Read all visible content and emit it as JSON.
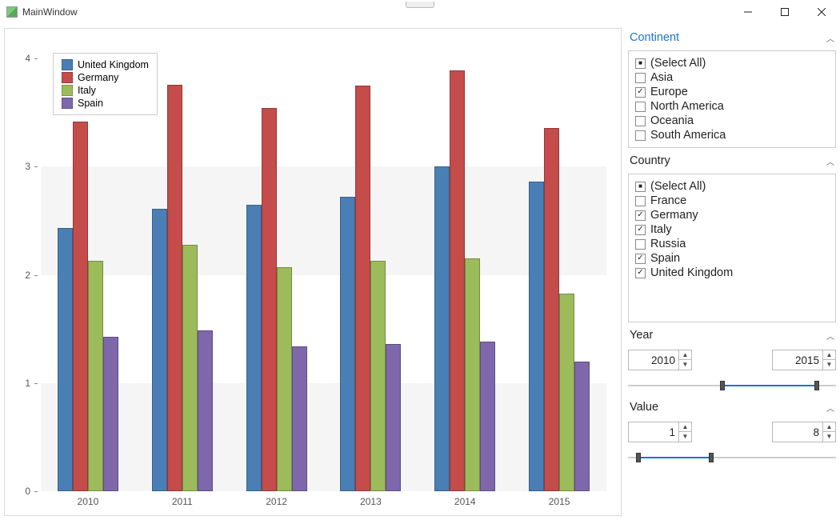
{
  "window": {
    "title": "MainWindow"
  },
  "colors": {
    "uk": "#4a7fb5",
    "germany": "#c44c4a",
    "italy": "#9cbb5a",
    "spain": "#7e68ab"
  },
  "chart_data": {
    "type": "bar",
    "categories": [
      "2010",
      "2011",
      "2012",
      "2013",
      "2014",
      "2015"
    ],
    "series": [
      {
        "name": "United Kingdom",
        "values": [
          2.43,
          2.61,
          2.65,
          2.72,
          3.0,
          2.86
        ],
        "color": "#4a7fb5"
      },
      {
        "name": "Germany",
        "values": [
          3.42,
          3.76,
          3.54,
          3.75,
          3.89,
          3.36
        ],
        "color": "#c44c4a"
      },
      {
        "name": "Italy",
        "values": [
          2.13,
          2.28,
          2.07,
          2.13,
          2.15,
          1.83
        ],
        "color": "#9cbb5a"
      },
      {
        "name": "Spain",
        "values": [
          1.43,
          1.49,
          1.34,
          1.36,
          1.38,
          1.2
        ],
        "color": "#7e68ab"
      }
    ],
    "ylim": [
      0,
      4.2
    ],
    "yticks": [
      0,
      1,
      2,
      3,
      4
    ],
    "xlabel": "",
    "ylabel": "",
    "title": ""
  },
  "filters": {
    "continent": {
      "label": "Continent",
      "items": [
        {
          "label": "(Select All)",
          "state": "mixed"
        },
        {
          "label": "Asia",
          "state": "off"
        },
        {
          "label": "Europe",
          "state": "on"
        },
        {
          "label": "North America",
          "state": "off"
        },
        {
          "label": "Oceania",
          "state": "off"
        },
        {
          "label": "South America",
          "state": "off"
        }
      ]
    },
    "country": {
      "label": "Country",
      "items": [
        {
          "label": "(Select All)",
          "state": "mixed"
        },
        {
          "label": "France",
          "state": "off"
        },
        {
          "label": "Germany",
          "state": "on"
        },
        {
          "label": "Italy",
          "state": "on"
        },
        {
          "label": "Russia",
          "state": "off"
        },
        {
          "label": "Spain",
          "state": "on"
        },
        {
          "label": "United Kingdom",
          "state": "on"
        }
      ]
    },
    "year": {
      "label": "Year",
      "from": "2010",
      "to": "2015",
      "track_min": 2005,
      "track_max": 2016,
      "lo": 2010,
      "hi": 2015
    },
    "value": {
      "label": "Value",
      "from": "1",
      "to": "8",
      "track_min": 0,
      "track_max": 20,
      "lo": 1,
      "hi": 8
    }
  }
}
